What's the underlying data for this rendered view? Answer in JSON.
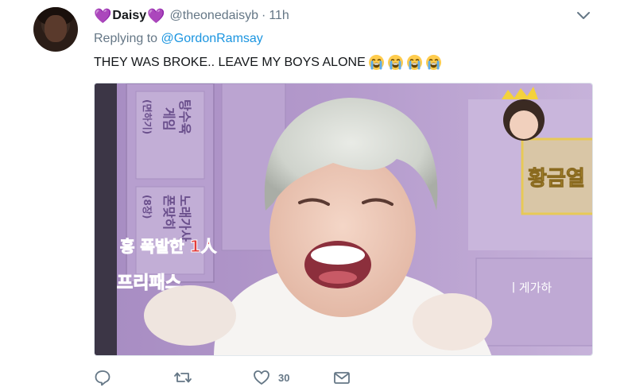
{
  "user": {
    "display_name": "Daisy",
    "name_decoration": "💜",
    "handle": "@theonedaisyb",
    "time": "11h",
    "separator": "·"
  },
  "reply": {
    "prefix": "Replying to ",
    "mention": "@GordonRamsay"
  },
  "tweet": {
    "text": "THEY WAS BROKE.. LEAVE MY BOYS ALONE",
    "emoji_count": 4,
    "emoji_icon": "loudly-crying-face-icon"
  },
  "media": {
    "overlay_caption": "홍 폭발한 1人",
    "board_lines": [
      "탕수육",
      "게임",
      "(면하기)",
      "노래가사",
      "폰맞히",
      "(8장)",
      "프리패스"
    ],
    "banner_text": "황금열"
  },
  "actions": {
    "like_count": "30"
  },
  "colors": {
    "accent": "#1b95e0",
    "secondary_text": "#657786",
    "heart": "#ab7fd6"
  }
}
